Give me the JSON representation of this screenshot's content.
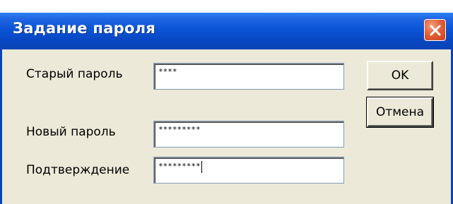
{
  "window": {
    "title": "Задание пароля",
    "close_icon": "close-icon"
  },
  "form": {
    "old_password_label": "Старый пароль",
    "old_password_value": "****",
    "new_password_label": "Новый пароль",
    "new_password_value": "*********",
    "confirm_label": "Подтверждение",
    "confirm_value": "*********"
  },
  "buttons": {
    "ok_label": "OK",
    "cancel_label": "Отмена"
  },
  "colors": {
    "titlebar": "#0a55d6",
    "close": "#e2613a",
    "dialog_bg": "#ece9d8"
  }
}
